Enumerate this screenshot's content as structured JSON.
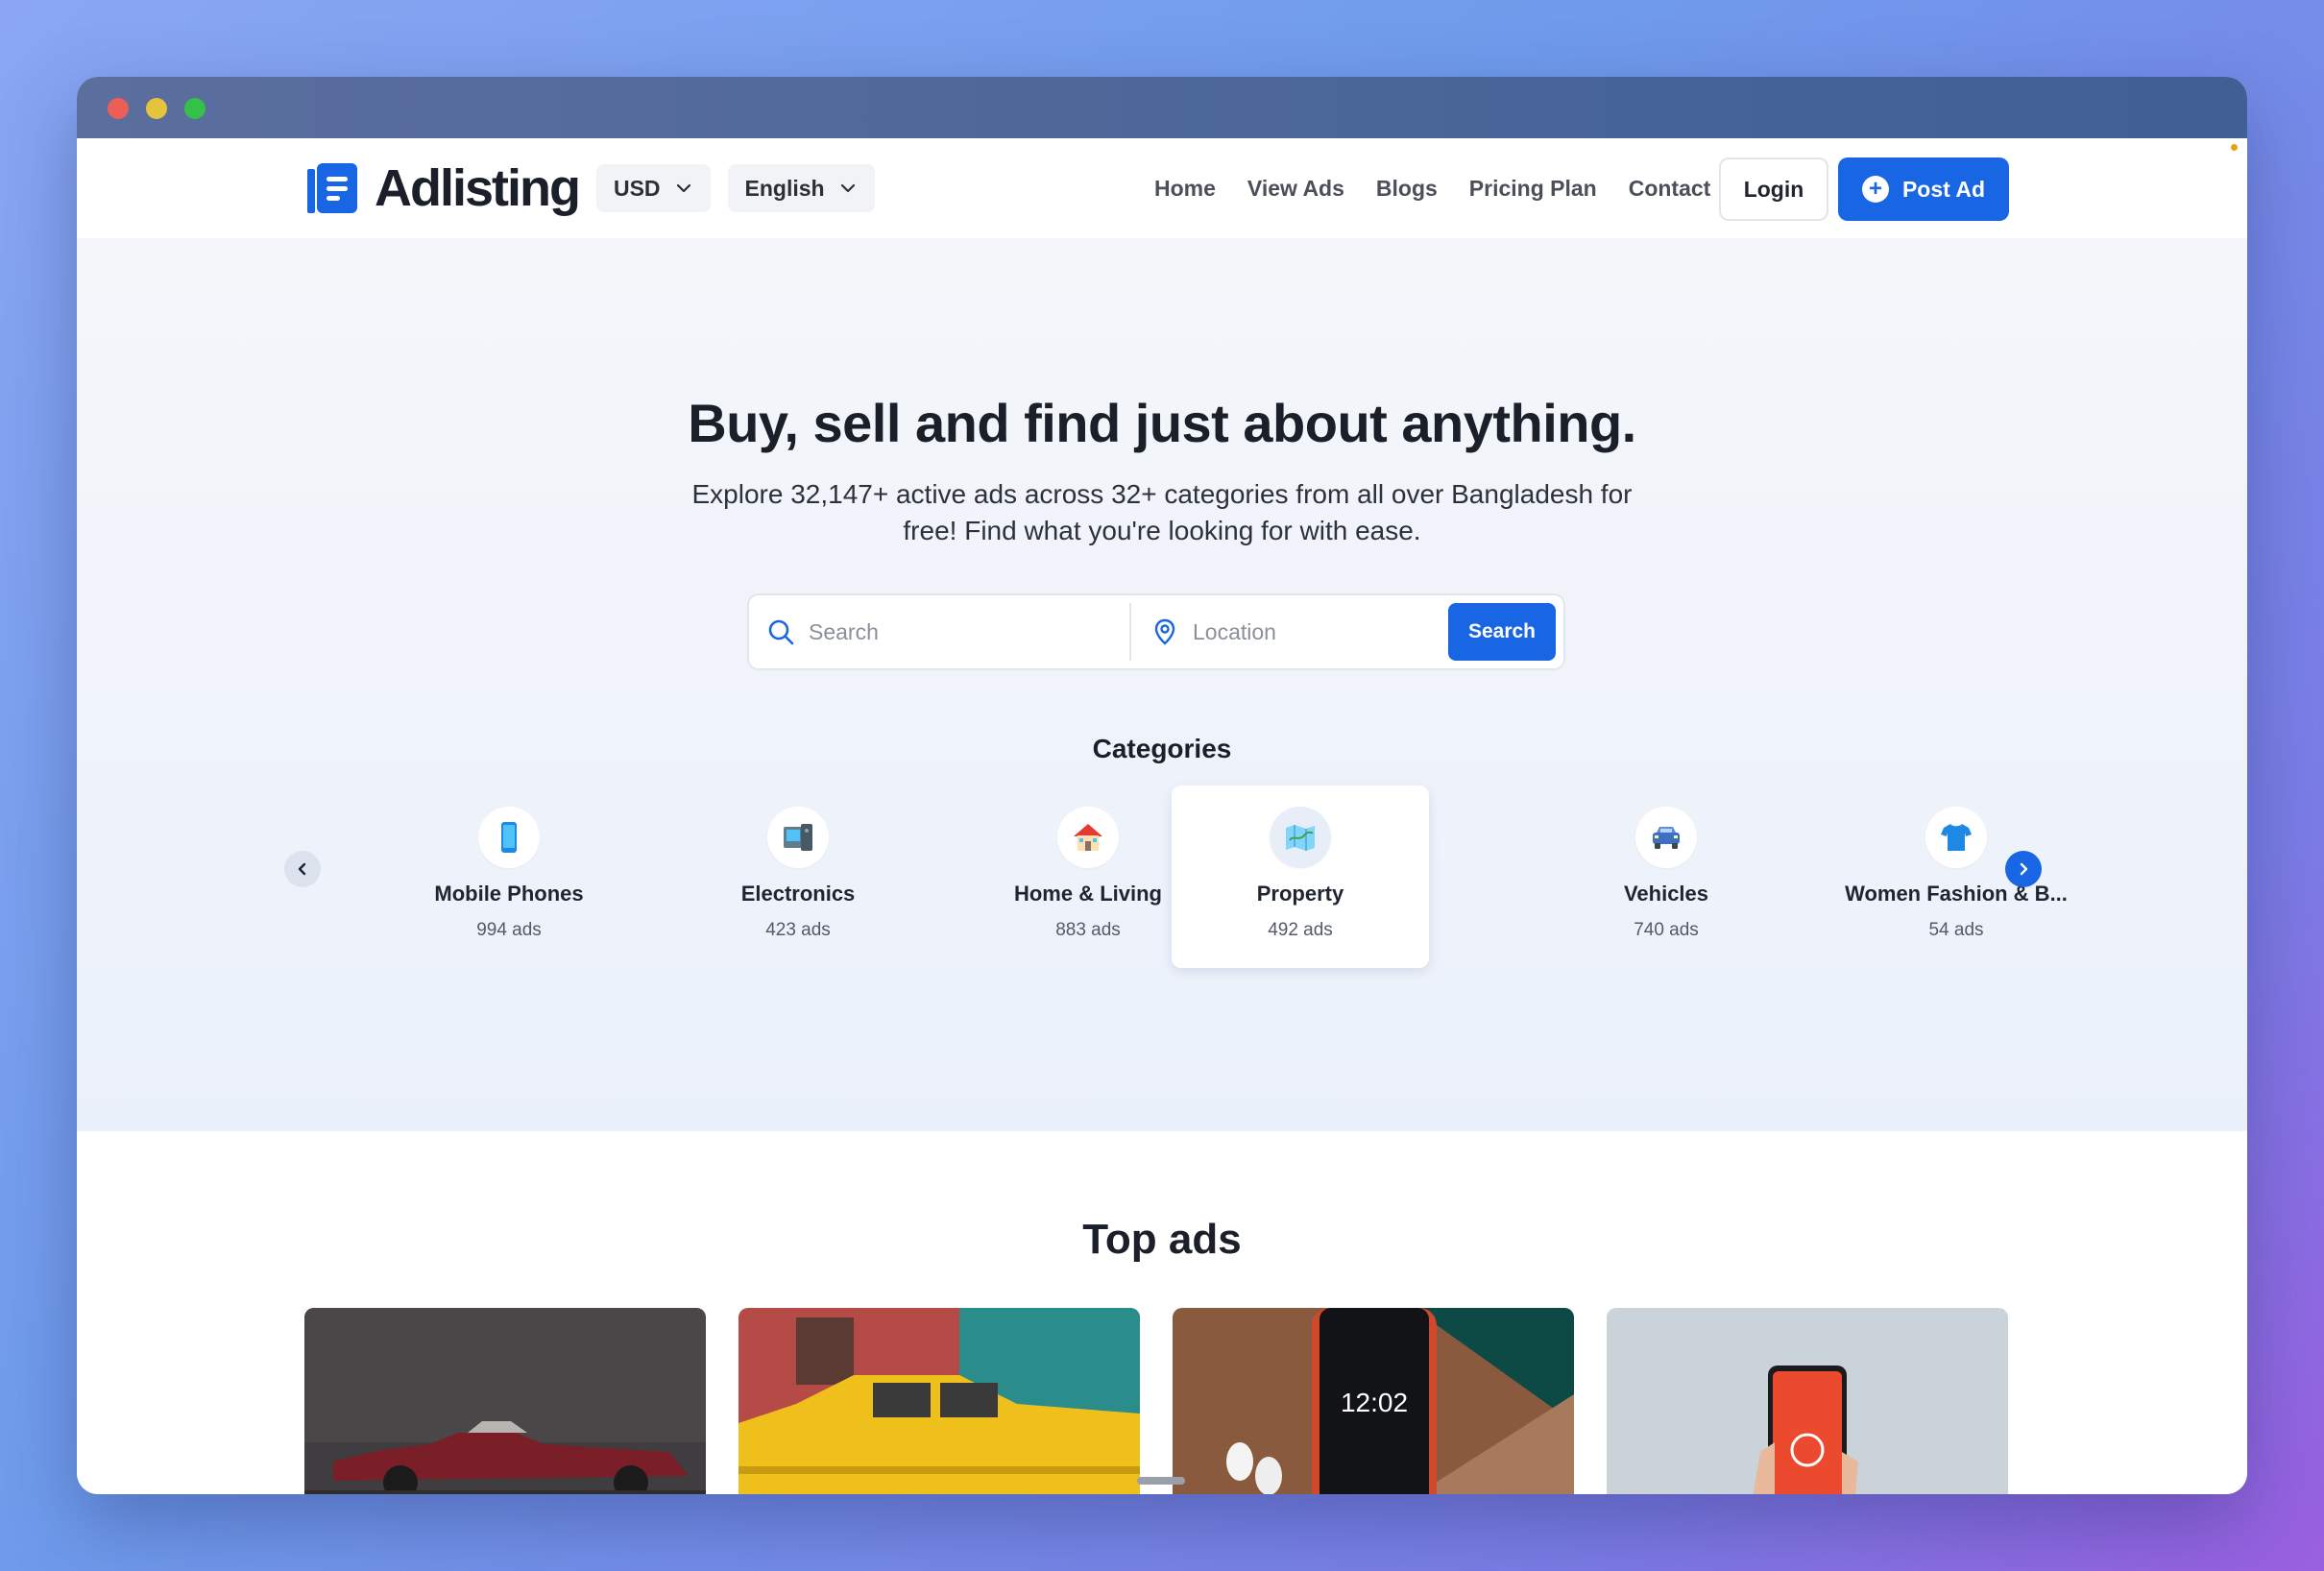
{
  "header": {
    "brand": "Adlisting",
    "currency": "USD",
    "language": "English",
    "nav": [
      "Home",
      "View Ads",
      "Blogs",
      "Pricing Plan",
      "Contact"
    ],
    "login_label": "Login",
    "post_ad_label": "Post Ad"
  },
  "hero": {
    "title": "Buy, sell and find just about anything.",
    "subtitle": "Explore 32,147+ active ads across 32+ categories from all over Bangladesh for free! Find what you're looking for with ease.",
    "search_placeholder": "Search",
    "location_placeholder": "Location",
    "search_button": "Search"
  },
  "categories": {
    "title": "Categories",
    "items": [
      {
        "name": "Mobile Phones",
        "count": "994 ads",
        "icon": "mobile-phone-icon"
      },
      {
        "name": "Electronics",
        "count": "423 ads",
        "icon": "electronics-icon"
      },
      {
        "name": "Home & Living",
        "count": "883 ads",
        "icon": "house-icon"
      },
      {
        "name": "Property",
        "count": "492 ads",
        "icon": "map-icon"
      },
      {
        "name": "Vehicles",
        "count": "740 ads",
        "icon": "car-icon"
      },
      {
        "name": "Women Fashion & B...",
        "count": "54 ads",
        "icon": "tshirt-icon"
      }
    ],
    "active_index": 3
  },
  "top_ads": {
    "title": "Top ads",
    "images": [
      "red-classic-car",
      "yellow-taxi-car",
      "iphone-with-airpods",
      "hand-holding-phone"
    ]
  },
  "colors": {
    "primary": "#1866e3",
    "text": "#1b1f29",
    "hero_bg": "#ebf1fb"
  }
}
